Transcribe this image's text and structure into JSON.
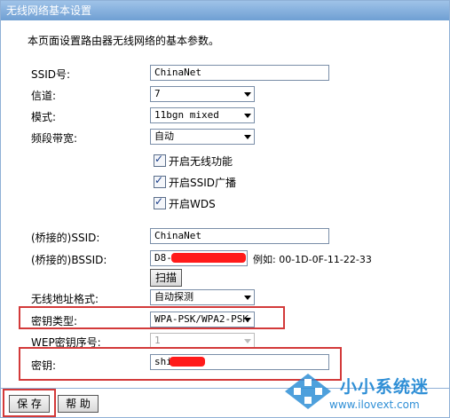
{
  "window": {
    "title": "无线网络基本设置"
  },
  "description": "本页面设置路由器无线网络的基本参数。",
  "fields": {
    "ssid": {
      "label": "SSID号:",
      "value": "ChinaNet"
    },
    "channel": {
      "label": "信道:",
      "value": "7"
    },
    "mode": {
      "label": "模式:",
      "value": "11bgn mixed"
    },
    "bandwidth": {
      "label": "频段带宽:",
      "value": "自动"
    },
    "bridge_ssid": {
      "label": "(桥接的)SSID:",
      "value": "ChinaNet"
    },
    "bridge_bssid": {
      "label": "(桥接的)BSSID:",
      "value": "D8-",
      "example": "例如: 00-1D-0F-11-22-33"
    },
    "addr_format": {
      "label": "无线地址格式:",
      "value": "自动探测"
    },
    "key_type": {
      "label": "密钥类型:",
      "value": "WPA-PSK/WPA2-PSK"
    },
    "wep_index": {
      "label": "WEP密钥序号:",
      "value": "1"
    },
    "key": {
      "label": "密钥:",
      "value": "shi"
    }
  },
  "checkboxes": {
    "enable_wireless": "开启无线功能",
    "enable_ssid_broadcast": "开启SSID广播",
    "enable_wds": "开启WDS"
  },
  "buttons": {
    "scan": "扫描",
    "save": "保 存",
    "help": "帮 助"
  },
  "watermark": {
    "text": "小小系统迷",
    "url": "www.ilovext.com"
  },
  "colors": {
    "highlight": "#d33a3a",
    "title_bar": "#7fa8da",
    "redaction": "#ff1a1a"
  }
}
